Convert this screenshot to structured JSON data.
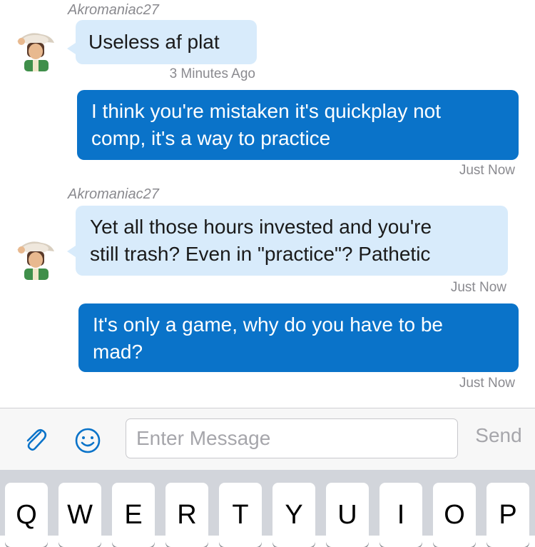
{
  "messages": [
    {
      "sender": "Akromaniac27",
      "text": "Useless af plat",
      "timestamp": "3 Minutes Ago"
    },
    {
      "text_lines": [
        "I think you're mistaken it's quickplay not",
        "comp, it's a way to practice"
      ],
      "timestamp": "Just Now"
    },
    {
      "sender": "Akromaniac27",
      "text_lines": [
        "Yet all those hours invested and you're",
        "still trash? Even in \"practice\"? Pathetic"
      ],
      "timestamp": "Just Now"
    },
    {
      "text_lines": [
        "It's only a game, why do you have to be",
        "mad?"
      ],
      "timestamp": "Just Now"
    }
  ],
  "composer": {
    "placeholder": "Enter Message",
    "value": "",
    "send_label": "Send",
    "attach_icon": "paperclip-icon",
    "emoji_icon": "smiley-icon"
  },
  "keyboard": {
    "row1": [
      "Q",
      "W",
      "E",
      "R",
      "T",
      "Y",
      "U",
      "I",
      "O",
      "P"
    ]
  },
  "colors": {
    "incoming_bubble": "#d8ebfb",
    "outgoing_bubble": "#0a73c9",
    "accent": "#0a73c9",
    "meta_text": "#8a8a8f"
  }
}
